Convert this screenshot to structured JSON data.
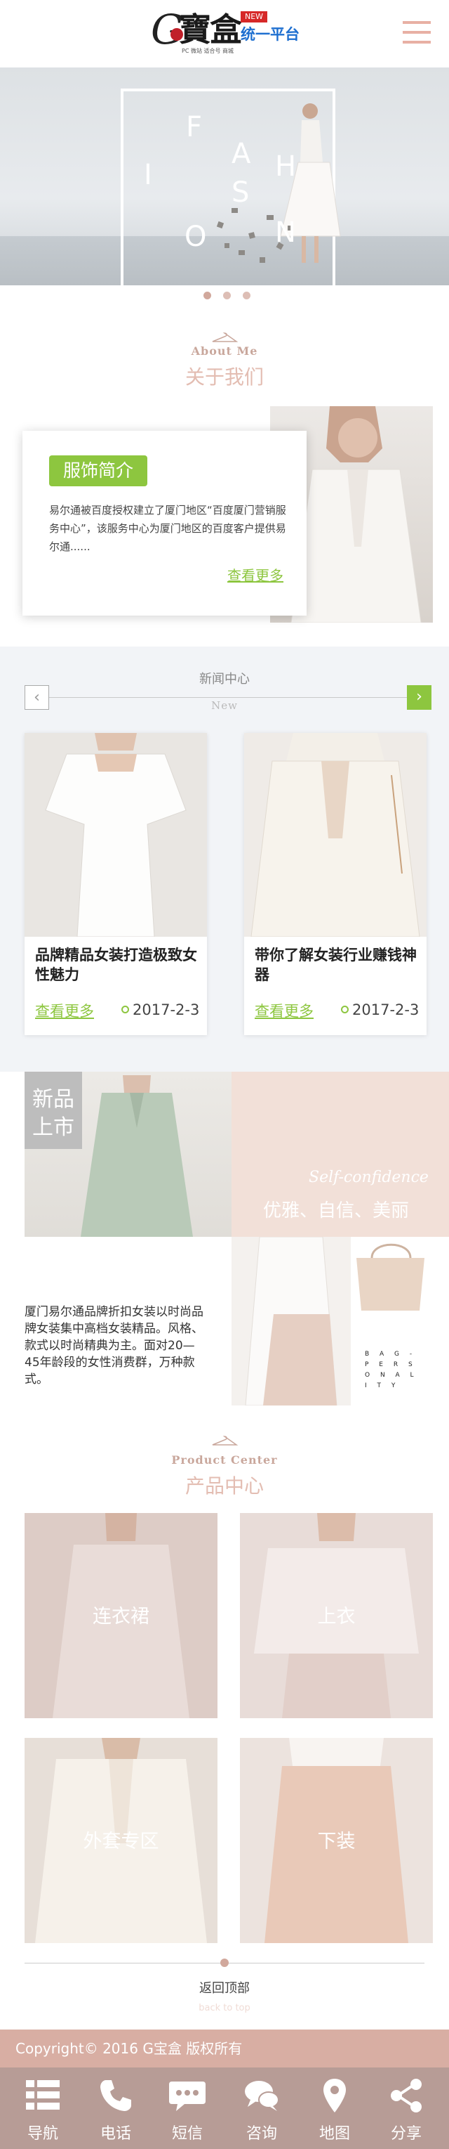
{
  "header": {
    "logo_letter": "G",
    "logo_chinese": "寶盒",
    "logo_badge": "NEW",
    "logo_subtitle": "统一平台",
    "logo_tagline": "PC 微站 适合号 商城",
    "menu_icon": "hamburger-menu-icon"
  },
  "banner": {
    "letters": [
      "F",
      "A",
      "I",
      "S",
      "H",
      "O",
      "N"
    ],
    "slide_count": 3,
    "active_slide": 1
  },
  "about": {
    "en_title": "About  Me",
    "cn_title": "关于我们",
    "badge": "服饰简介",
    "text": "易尔通被百度授权建立了厦门地区“百度厦门营销服务中心”，该服务中心为厦门地区的百度客户提供易尔通......",
    "more": "查看更多"
  },
  "news": {
    "cn_title": "新闻中心",
    "en_title": "New",
    "prev_icon": "chevron-left-icon",
    "next_icon": "chevron-right-icon",
    "items": [
      {
        "title": "品牌精品女装打造极致女性魅力",
        "more": "查看更多",
        "date": "2017-2-3"
      },
      {
        "title": "带你了解女装行业赚钱神器",
        "more": "查看更多",
        "date": "2017-2-3"
      }
    ]
  },
  "new_arrivals": {
    "tag": "新品上市",
    "tag_line1": "新品",
    "tag_line2": "上市",
    "script": "Self-confidence",
    "slogan": "优雅、自信、美丽",
    "text": "厦门易尔通品牌折扣女装以时尚品牌女装集中高档女装精品。风格、款式以时尚精典为主。面对20—45年龄段的女性消费群，万种款式。",
    "bag_text": "B A G - P E R S O N A L I T Y"
  },
  "products": {
    "en_title": "Product Center",
    "cn_title": "产品中心",
    "items": [
      {
        "label": "连衣裙"
      },
      {
        "label": "上衣"
      },
      {
        "label": "外套专区"
      },
      {
        "label": "下装"
      }
    ]
  },
  "back_to_top": {
    "cn": "返回顶部",
    "en": "back to top"
  },
  "footer": {
    "copyright": "Copyright© 2016  G宝盒 版权所有",
    "nav": [
      {
        "label": "导航",
        "icon": "grid-menu-icon"
      },
      {
        "label": "电话",
        "icon": "phone-icon"
      },
      {
        "label": "短信",
        "icon": "sms-bubble-icon"
      },
      {
        "label": "咨询",
        "icon": "chat-bubbles-icon"
      },
      {
        "label": "地图",
        "icon": "map-pin-icon"
      },
      {
        "label": "分享",
        "icon": "share-icon"
      }
    ]
  },
  "colors": {
    "accent_green": "#8dc63f",
    "accent_pink": "#d8aea3",
    "nav_bg": "#b79c96"
  }
}
